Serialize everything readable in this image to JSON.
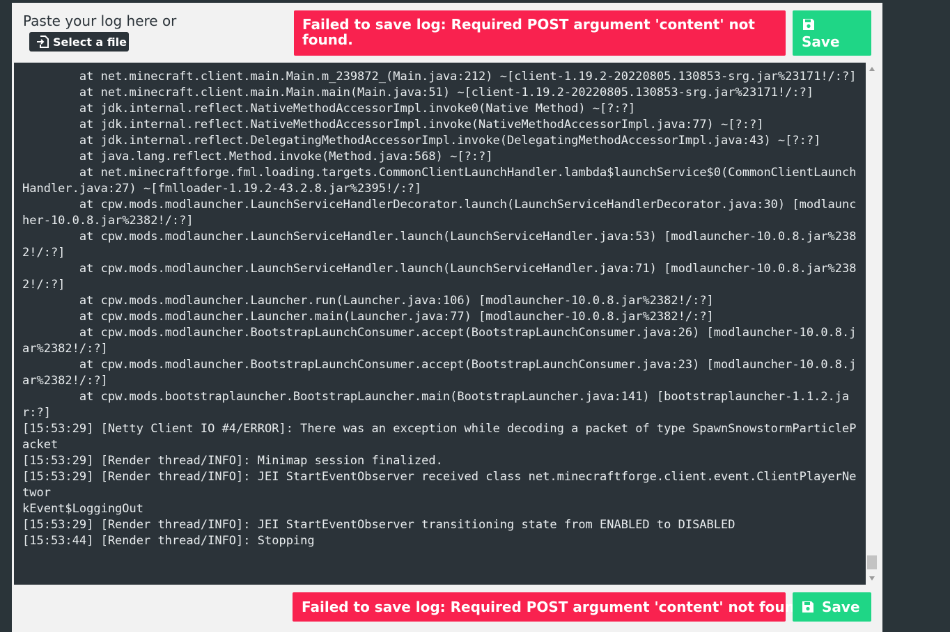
{
  "header": {
    "label": "Paste your log here or",
    "select_file_label": "Select a file"
  },
  "error_message_top": "Failed to save log: Required POST argument 'content' not found.",
  "error_message_bottom": "Failed to save log: Required POST argument 'content' not found.",
  "save_label": "Save",
  "colors": {
    "error": "#f9224f",
    "success": "#1fd686",
    "dark": "#2b3339"
  },
  "icons": {
    "select_file": "file-import-icon",
    "save": "floppy-disk-icon"
  },
  "log_lines": [
    "\tat net.minecraft.client.main.Main.m_239872_(Main.java:212) ~[client-1.19.2-20220805.130853-srg.jar%23171!/:?]",
    "\tat net.minecraft.client.main.Main.main(Main.java:51) ~[client-1.19.2-20220805.130853-srg.jar%23171!/:?]",
    "\tat jdk.internal.reflect.NativeMethodAccessorImpl.invoke0(Native Method) ~[?:?]",
    "\tat jdk.internal.reflect.NativeMethodAccessorImpl.invoke(NativeMethodAccessorImpl.java:77) ~[?:?]",
    "\tat jdk.internal.reflect.DelegatingMethodAccessorImpl.invoke(DelegatingMethodAccessorImpl.java:43) ~[?:?]",
    "\tat java.lang.reflect.Method.invoke(Method.java:568) ~[?:?]",
    "\tat net.minecraftforge.fml.loading.targets.CommonClientLaunchHandler.lambda$launchService$0(CommonClientLaunchHandler.java:27) ~[fmlloader-1.19.2-43.2.8.jar%2395!/:?]",
    "\tat cpw.mods.modlauncher.LaunchServiceHandlerDecorator.launch(LaunchServiceHandlerDecorator.java:30) [modlauncher-10.0.8.jar%2382!/:?]",
    "\tat cpw.mods.modlauncher.LaunchServiceHandler.launch(LaunchServiceHandler.java:53) [modlauncher-10.0.8.jar%2382!/:?]",
    "\tat cpw.mods.modlauncher.LaunchServiceHandler.launch(LaunchServiceHandler.java:71) [modlauncher-10.0.8.jar%2382!/:?]",
    "\tat cpw.mods.modlauncher.Launcher.run(Launcher.java:106) [modlauncher-10.0.8.jar%2382!/:?]",
    "\tat cpw.mods.modlauncher.Launcher.main(Launcher.java:77) [modlauncher-10.0.8.jar%2382!/:?]",
    "\tat cpw.mods.modlauncher.BootstrapLaunchConsumer.accept(BootstrapLaunchConsumer.java:26) [modlauncher-10.0.8.jar%2382!/:?]",
    "\tat cpw.mods.modlauncher.BootstrapLaunchConsumer.accept(BootstrapLaunchConsumer.java:23) [modlauncher-10.0.8.jar%2382!/:?]",
    "\tat cpw.mods.bootstraplauncher.BootstrapLauncher.main(BootstrapLauncher.java:141) [bootstraplauncher-1.1.2.jar:?]",
    "[15:53:29] [Netty Client IO #4/ERROR]: There was an exception while decoding a packet of type SpawnSnowstormParticlePacket",
    "[15:53:29] [Render thread/INFO]: Minimap session finalized.",
    "[15:53:29] [Render thread/INFO]: JEI StartEventObserver received class net.minecraftforge.client.event.ClientPlayerNetwor",
    "kEvent$LoggingOut",
    "[15:53:29] [Render thread/INFO]: JEI StartEventObserver transitioning state from ENABLED to DISABLED",
    "[15:53:44] [Render thread/INFO]: Stopping"
  ]
}
